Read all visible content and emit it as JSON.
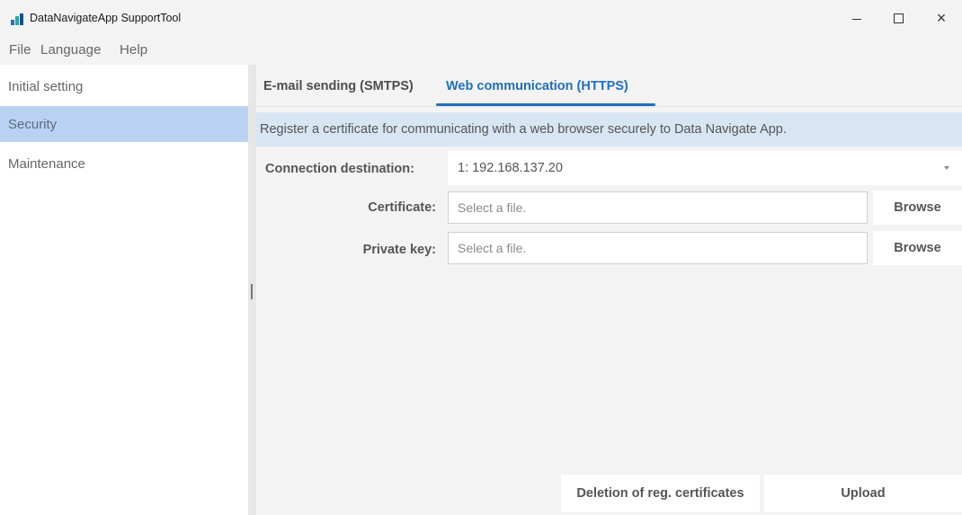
{
  "window": {
    "title": "DataNavigateApp SupportTool",
    "close_glyph": "×"
  },
  "menu": {
    "items": [
      "File",
      "Language",
      "Help"
    ]
  },
  "sidebar": {
    "items": [
      {
        "label": "Initial setting",
        "selected": false
      },
      {
        "label": "Security",
        "selected": true
      },
      {
        "label": "Maintenance",
        "selected": false
      }
    ]
  },
  "tabs": [
    {
      "label": "E-mail sending (SMTPS)",
      "active": false
    },
    {
      "label": "Web communication (HTTPS)",
      "active": true
    }
  ],
  "main": {
    "info_text": "Register a certificate for communicating with a web browser securely to Data Navigate App.",
    "connection_label": "Connection destination:",
    "connection_value": "1: 192.168.137.20",
    "certificate_label": "Certificate:",
    "certificate_placeholder": "Select a file.",
    "private_key_label": "Private key:",
    "private_key_placeholder": "Select a file.",
    "browse_label": "Browse",
    "delete_button": "Deletion of reg. certificates",
    "upload_button": "Upload"
  },
  "colors": {
    "accent": "#1f6fbf",
    "sidebar_selected": "#bad2f2",
    "info_banner": "#d8e6f3",
    "logo_bars": [
      "#1e73c8",
      "#2aa6a0",
      "#1b4f8f"
    ]
  }
}
